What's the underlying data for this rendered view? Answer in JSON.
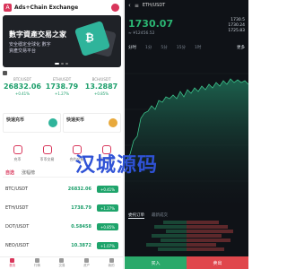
{
  "left": {
    "app_title": "Ads+Chain Exchange",
    "banner": {
      "headline": "數字資產交易之家",
      "sub": "安全穩定全球化 數字資產交易平台"
    },
    "tickers": [
      {
        "name": "BTC/USDT",
        "price": "26832.06",
        "change": "+0.41%"
      },
      {
        "name": "ETH/USDT",
        "price": "1738.79",
        "change": "+1.27%"
      },
      {
        "name": "BCH/USDT",
        "price": "13.2887",
        "change": "+0.85%"
      }
    ],
    "quick": [
      {
        "title": "快速充币",
        "icon_color": "#2fb49b"
      },
      {
        "title": "快速买币",
        "icon_color": "#e8a93c"
      }
    ],
    "menu": [
      {
        "label": "充币"
      },
      {
        "label": "币币交易"
      },
      {
        "label": "合约交易"
      },
      {
        "label": "帮助中心"
      }
    ],
    "tabs": [
      {
        "label": "自选"
      },
      {
        "label": "涨幅榜"
      }
    ],
    "market": [
      {
        "pair": "BTC/USDT",
        "price": "26832.06",
        "pct": "+0.41%"
      },
      {
        "pair": "ETH/USDT",
        "price": "1738.79",
        "pct": "+1.27%"
      },
      {
        "pair": "DOT/USDT",
        "price": "0.58458",
        "pct": "+0.85%"
      },
      {
        "pair": "NEO/USDT",
        "price": "10.3872",
        "pct": "+1.07%"
      }
    ],
    "bottom_nav": [
      {
        "label": "首页"
      },
      {
        "label": "行情"
      },
      {
        "label": "交易"
      },
      {
        "label": "资产"
      },
      {
        "label": "我的"
      }
    ]
  },
  "right": {
    "pair": "ETH/USDT",
    "price": "1730.07",
    "price_sub": "≈ ¥12456.52",
    "stats": [
      "1730.5",
      "1730.24",
      "1725.83"
    ],
    "period_tabs": [
      "分时",
      "1分",
      "5分",
      "15分",
      "1时"
    ],
    "more_label": "更多",
    "depth_tabs": [
      "委托订单",
      "最新成交"
    ],
    "buy_label": "买入",
    "sell_label": "卖出"
  },
  "watermark": "汉城源码",
  "colors": {
    "accent": "#d9365b",
    "up": "#1b9e6a",
    "down": "#e0474c",
    "dark_bg": "#0f1217"
  }
}
